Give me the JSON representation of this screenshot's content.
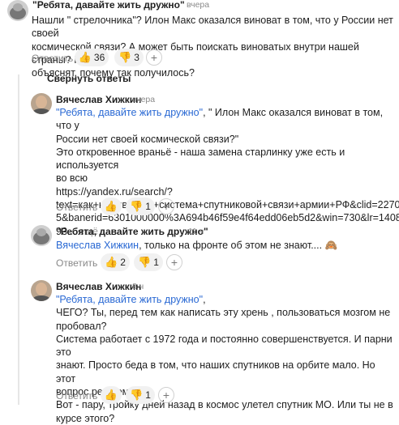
{
  "c1": {
    "username": "\"Ребята, давайте жить дружно\"",
    "time": "вчера",
    "lines": [
      "Нашли \" стрелочника\"? Илон Макс оказался виноват в том, что у России нет своей",
      "космической связи? А может быть поискать виноватых внутри нашей страны? Пусть",
      "объяснят, почему так получилось?"
    ],
    "reply_label": "Ответить",
    "likes": "36",
    "dislikes": "3",
    "plus": "+"
  },
  "collapse_label": "Свернуть ответы",
  "r1": {
    "username": "Вячеслав Хижкин",
    "time": "вчера",
    "quote_link": "\"Ребята, давайте жить дружно\"",
    "line1_rest": ", \" Илон Макс оказался виноват в том, что у",
    "lines": [
      "России нет своей космической связи?\"",
      "Это откровенное враньё - наша замена старлинку уже есть и используется",
      "во всю",
      "https://yandex.ru/search/?",
      "text=как+называется+система+спутниковой+связи+армии+РФ&clid=227045",
      "5&banerid=6301000000%3A694b46f59e4f64edd06eb5d2&win=730&lr=1408"
    ],
    "last_line": "93...",
    "more": "ещё",
    "reply_label": "Ответить",
    "likes": "",
    "dislikes": "1",
    "plus": "+"
  },
  "r2": {
    "username": "\"Ребята, давайте жить дружно\"",
    "time": "11 ч",
    "mention": "Вячеслав Хижкин",
    "text": ", только на фронте об этом не знают....",
    "emoji": "🙈",
    "reply_label": "Ответить",
    "likes": "2",
    "dislikes": "1",
    "plus": "+"
  },
  "r3": {
    "username": "Вячеслав Хижкин",
    "time": "8 ч",
    "quote_link": "\"Ребята, давайте жить дружно\"",
    "quote_tail": ",",
    "lines": [
      "ЧЕГО? Ты, перед тем как написать эту хрень , пользоваться мозгом не",
      "пробовал?",
      "Система работает с 1972 года и постоянно совершенствуется. И парни это",
      "знают. Просто беда в том, что наших спутников на орбите мало. Но этот",
      "вопрос решаемый.",
      "Вот - пару, тройку дней назад в космос улетел спутник МО. Или ты не в",
      "курсе этого?"
    ],
    "reply_label": "Ответить",
    "likes": "",
    "dislikes": "1",
    "plus": "+"
  },
  "icons": {
    "like": "👍",
    "dislike": "👎"
  }
}
